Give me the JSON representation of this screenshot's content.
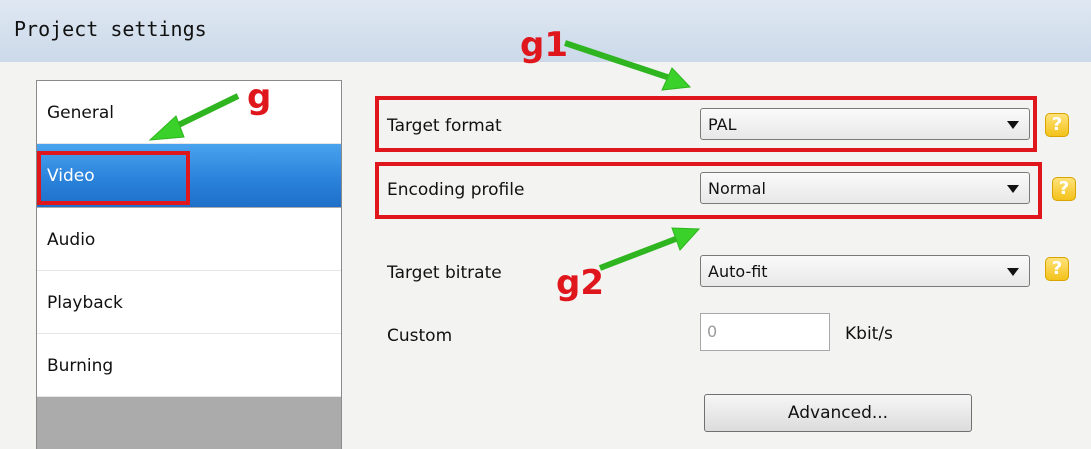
{
  "window": {
    "title": "Project settings"
  },
  "sidebar": {
    "items": [
      {
        "label": "General",
        "selected": false
      },
      {
        "label": "Video",
        "selected": true
      },
      {
        "label": "Audio",
        "selected": false
      },
      {
        "label": "Playback",
        "selected": false
      },
      {
        "label": "Burning",
        "selected": false
      }
    ]
  },
  "settings": {
    "target_format": {
      "label": "Target format",
      "value": "PAL"
    },
    "encoding_profile": {
      "label": "Encoding profile",
      "value": "Normal"
    },
    "target_bitrate": {
      "label": "Target bitrate",
      "value": "Auto-fit"
    },
    "custom": {
      "label": "Custom",
      "value": "0",
      "unit": "Kbit/s"
    },
    "advanced_button": "Advanced...",
    "help_icon_glyph": "?"
  },
  "annotations": {
    "g": "g",
    "g1": "g1",
    "g2": "g2",
    "highlight_color": "#e0161d",
    "arrow_color": "#3ad22a"
  }
}
